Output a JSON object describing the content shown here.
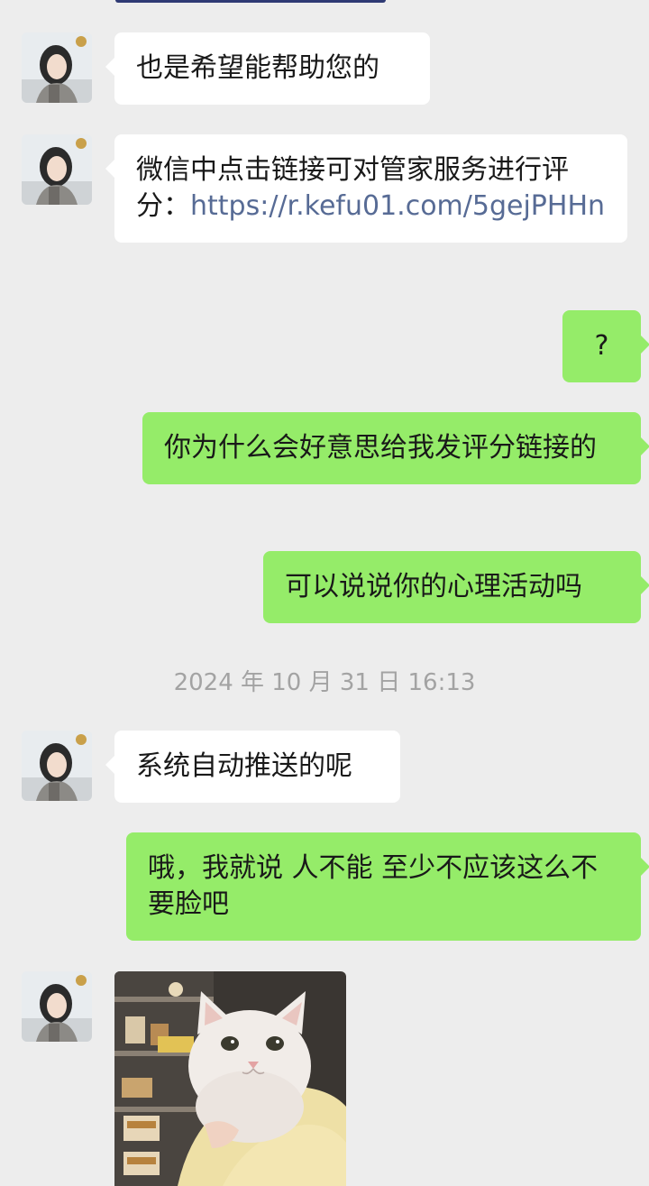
{
  "messages": [
    {
      "side": "in",
      "text": "也是希望能帮助您的"
    },
    {
      "side": "in",
      "text_prefix": "微信中点击链接可对管家服务进行评分：",
      "link": "https://r.kefu01.com/5gejPHHn"
    },
    {
      "side": "out",
      "text": "?"
    },
    {
      "side": "out",
      "text": "你为什么会好意思给我发评分链接的"
    },
    {
      "side": "out",
      "text": "可以说说你的心理活动吗"
    },
    {
      "side": "in",
      "text": "系统自动推送的呢"
    },
    {
      "side": "out",
      "text": "哦，我就说 人不能 至少不应该这么不要脸吧"
    },
    {
      "side": "in",
      "type": "image",
      "image": "white-cat-photo"
    }
  ],
  "timestamp": "2024 年 10 月 31 日 16:13",
  "colors": {
    "background": "#ededed",
    "incoming_bubble": "#ffffff",
    "outgoing_bubble": "#95ec69",
    "link": "#576b95",
    "timestamp_text": "#a3a3a3"
  }
}
